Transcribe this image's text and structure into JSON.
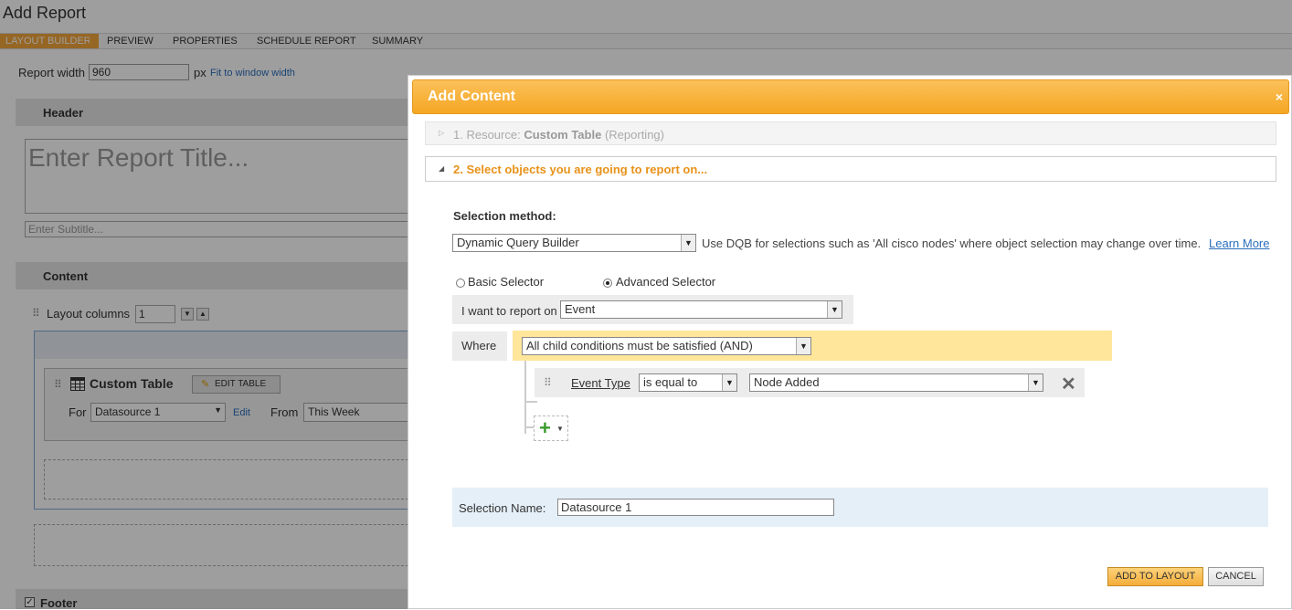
{
  "page": {
    "title": "Add Report",
    "wizard_steps": [
      "LAYOUT BUILDER",
      "PREVIEW",
      "PROPERTIES",
      "SCHEDULE REPORT",
      "SUMMARY"
    ],
    "active_step": "LAYOUT BUILDER",
    "report_width_label": "Report width",
    "report_width_value": "960",
    "px_label": "px",
    "fit_link": "Fit to window width",
    "header_label": "Header",
    "title_placeholder": "Enter Report Title...",
    "subtitle_placeholder": "Enter Subtitle...",
    "content_label": "Content",
    "layout_columns_label": "Layout columns",
    "layout_columns_value": "1",
    "custom_table": {
      "title": "Custom Table",
      "edit_button": "EDIT TABLE",
      "for_label": "For",
      "datasource": "Datasource 1",
      "edit_link": "Edit",
      "from_label": "From",
      "from_value": "This Week"
    },
    "footer_label": "Footer",
    "footer_checked": true
  },
  "dialog": {
    "title": "Add Content",
    "close_glyph": "×",
    "step1": {
      "prefix": "1. Resource:",
      "resource": "Custom Table",
      "suffix": "(Reporting)"
    },
    "step2": "2. Select objects you are going to report on...",
    "selection_method_label": "Selection method:",
    "selection_method_value": "Dynamic Query Builder",
    "dqb_help": "Use DQB for selections such as 'All cisco nodes' where object selection may change over time.",
    "learn_more": "Learn More",
    "basic_selector": "Basic Selector",
    "advanced_selector": "Advanced Selector",
    "selected_selector": "advanced",
    "report_on_label": "I want to report on",
    "report_on_value": "Event",
    "where_label": "Where",
    "condition_value": "All child conditions must be satisfied (AND)",
    "rule": {
      "field": "Event Type",
      "operator": "is equal to",
      "value": "Node Added"
    },
    "selection_name_label": "Selection Name:",
    "selection_name_value": "Datasource 1",
    "add_to_layout": "ADD TO LAYOUT",
    "cancel": "CANCEL"
  },
  "colors": {
    "accent_orange": "#f5a623",
    "step2_text": "#e8921a",
    "condition_bar": "#ffe69a",
    "selection_name_bg": "#e5eff8",
    "link": "#2a6ebb"
  }
}
